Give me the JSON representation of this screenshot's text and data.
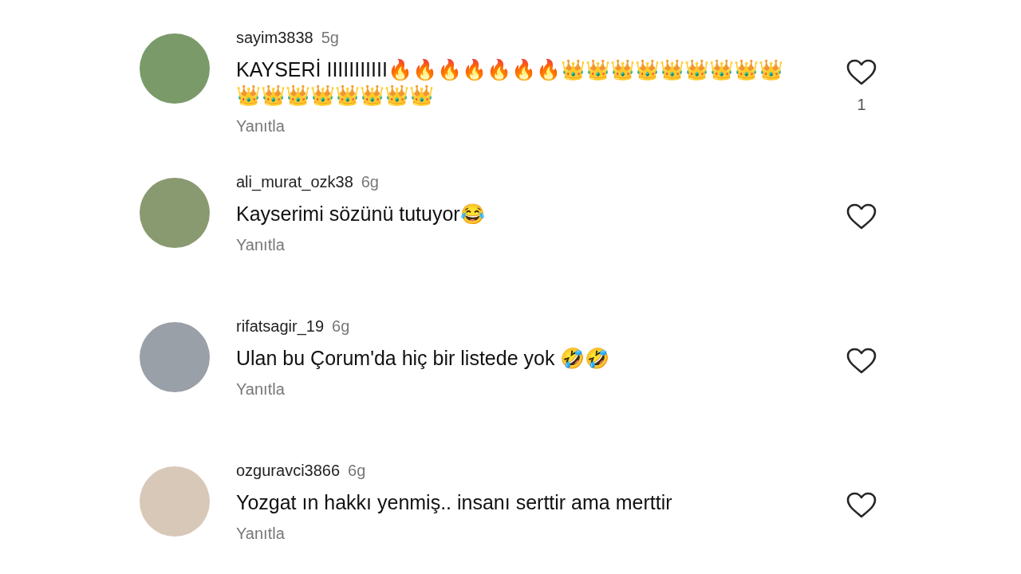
{
  "comments": [
    {
      "username": "sayim3838",
      "time": "5g",
      "text": "KAYSERİ IIIIIIIIIII🔥🔥🔥🔥🔥🔥🔥👑👑👑👑👑👑👑👑👑👑👑👑👑👑👑👑👑",
      "reply": "Yanıtla",
      "likes": "1"
    },
    {
      "username": "ali_murat_ozk38",
      "time": "6g",
      "text": "Kayserimi sözünü tutuyor😂",
      "reply": "Yanıtla"
    },
    {
      "username": "rifatsagir_19",
      "time": "6g",
      "text": "Ulan bu Çorum'da hiç bir listede yok 🤣🤣",
      "reply": "Yanıtla"
    },
    {
      "username": "ozguravci3866",
      "time": "6g",
      "text": "Yozgat ın hakkı yenmiş.. insanı serttir ama merttir",
      "reply": "Yanıtla"
    }
  ]
}
